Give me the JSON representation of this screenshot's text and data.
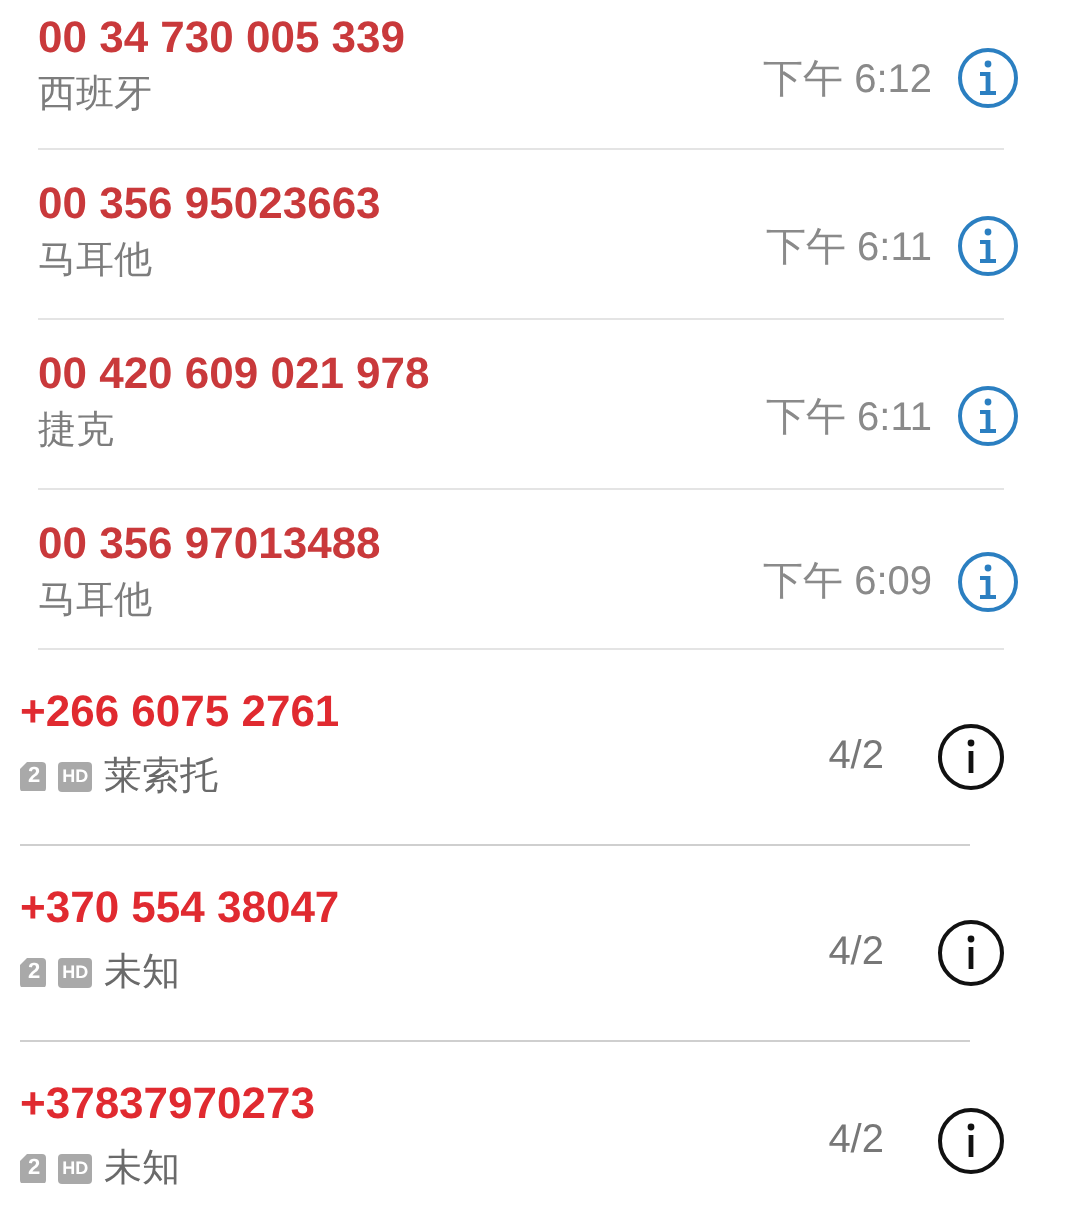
{
  "sections": [
    {
      "kind": "ios",
      "rows": [
        {
          "number": "00 34 730 005 339",
          "location": "西班牙",
          "time": "下午 6:12"
        },
        {
          "number": "00 356 95023663",
          "location": "马耳他",
          "time": "下午 6:11"
        },
        {
          "number": "00 420 609 021 978",
          "location": "捷克",
          "time": "下午 6:11"
        },
        {
          "number": "00 356 97013488",
          "location": "马耳他",
          "time": "下午 6:09"
        }
      ]
    },
    {
      "kind": "android",
      "rows": [
        {
          "number": "+266 6075 2761",
          "badges": [
            {
              "kind": "sim",
              "text": "2"
            },
            {
              "kind": "hd",
              "text": "HD"
            }
          ],
          "location": "莱索托",
          "time": "4/2"
        },
        {
          "number": "+370 554 38047",
          "badges": [
            {
              "kind": "sim",
              "text": "2"
            },
            {
              "kind": "hd",
              "text": "HD"
            }
          ],
          "location": "未知",
          "time": "4/2"
        },
        {
          "number": "+37837970273",
          "badges": [
            {
              "kind": "sim",
              "text": "2"
            },
            {
              "kind": "hd",
              "text": "HD"
            }
          ],
          "location": "未知",
          "time": "4/2"
        }
      ]
    }
  ]
}
